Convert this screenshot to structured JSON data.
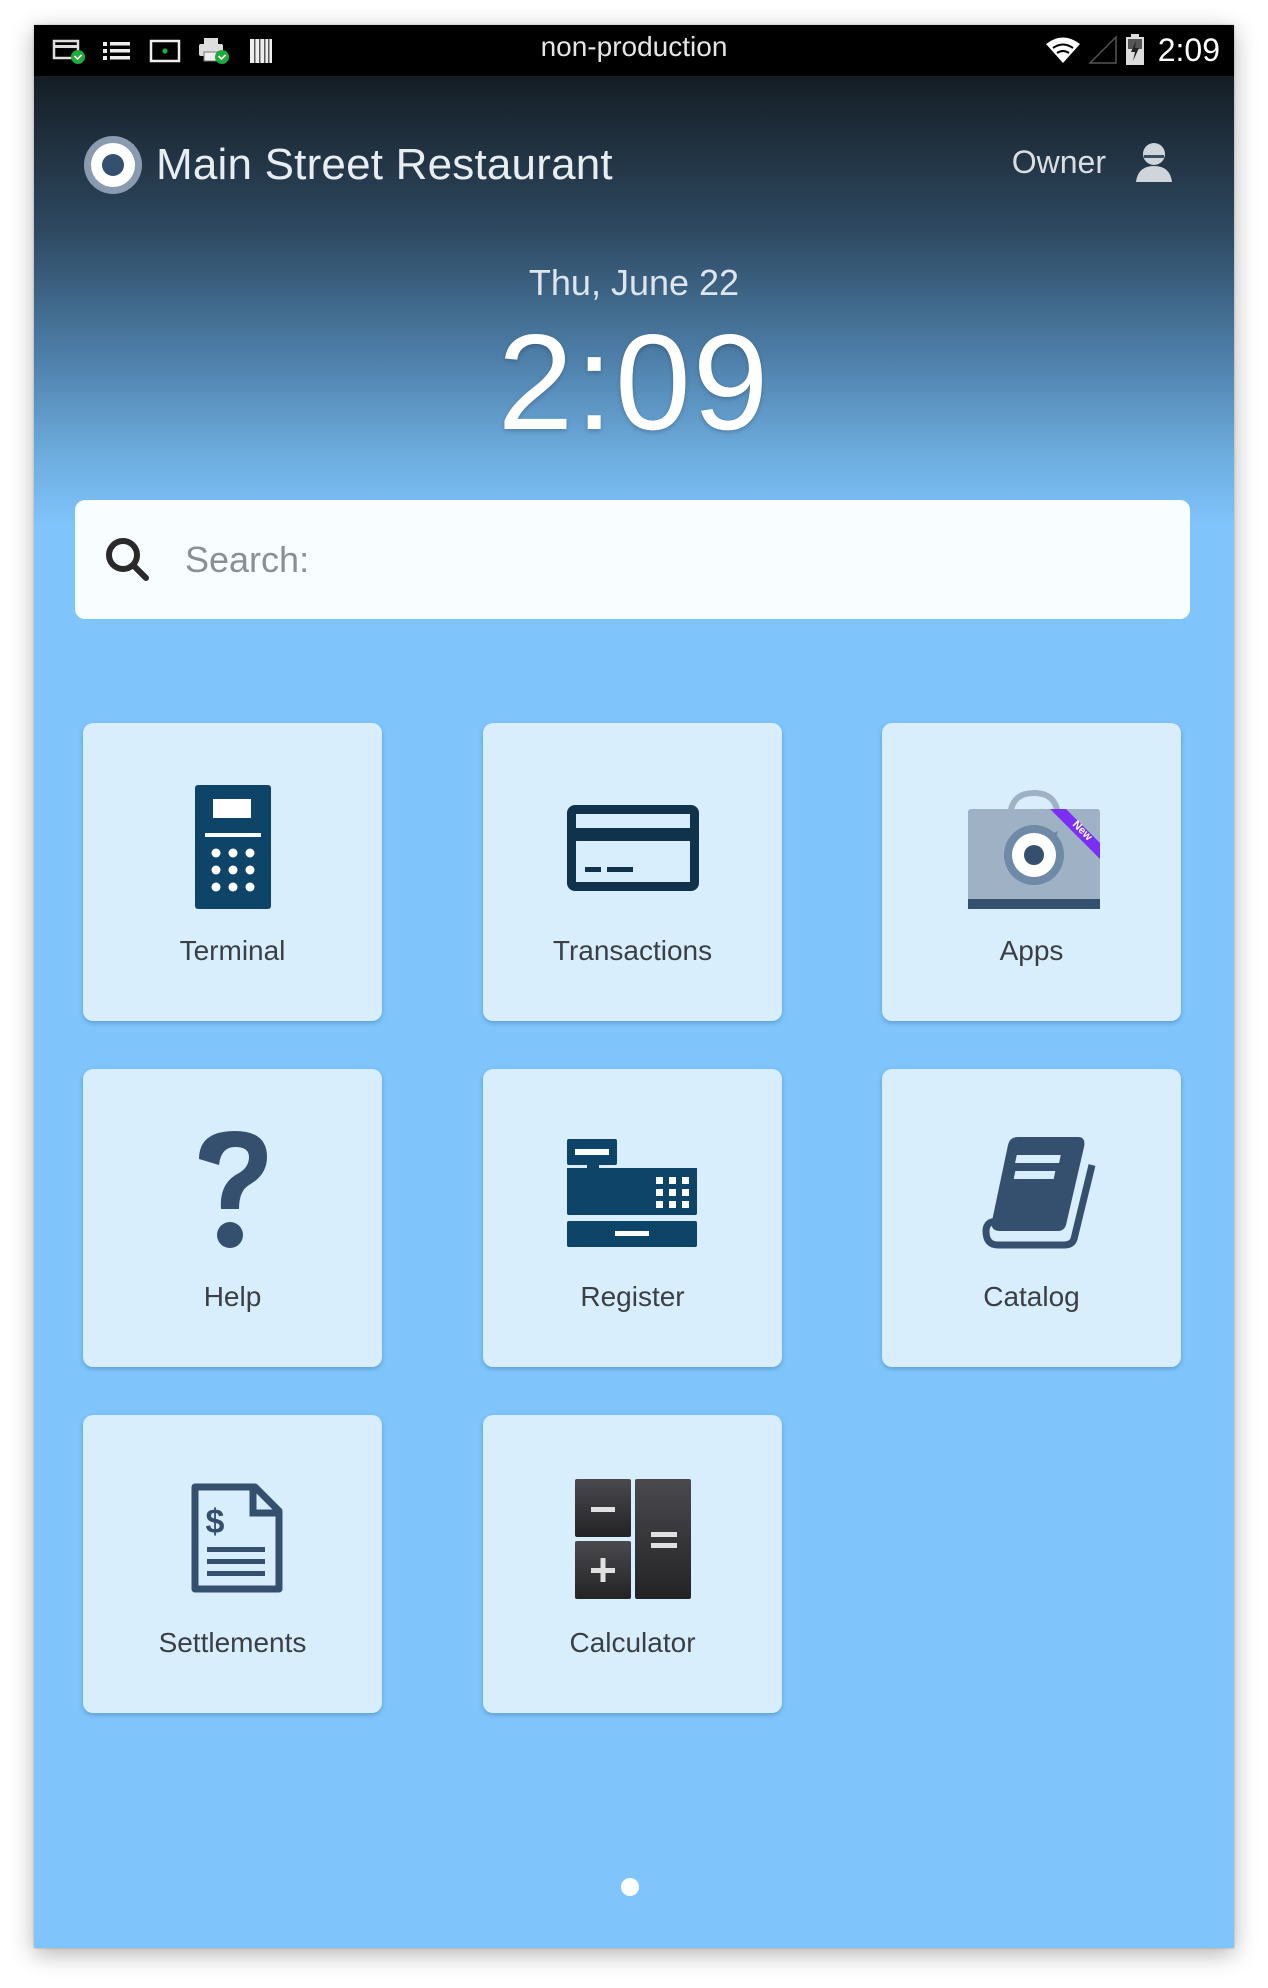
{
  "status_bar": {
    "environment_label": "non-production",
    "time": "2:09",
    "left_icons": [
      "card-reader-connected-icon",
      "list-icon",
      "screen-icon",
      "printer-connected-icon",
      "barcode-icon"
    ],
    "right_icons": [
      "wifi-icon",
      "cell-signal-icon",
      "battery-charging-icon"
    ]
  },
  "header": {
    "merchant_name": "Main Street Restaurant",
    "user_role": "Owner",
    "date": "Thu, June 22",
    "time": "2:09"
  },
  "search": {
    "placeholder": "Search:",
    "value": ""
  },
  "apps": [
    {
      "label": "Terminal",
      "icon": "terminal-icon"
    },
    {
      "label": "Transactions",
      "icon": "credit-card-icon"
    },
    {
      "label": "Apps",
      "icon": "app-market-bag-icon",
      "badge": "New"
    },
    {
      "label": "Help",
      "icon": "question-mark-icon"
    },
    {
      "label": "Register",
      "icon": "cash-register-icon"
    },
    {
      "label": "Catalog",
      "icon": "book-icon"
    },
    {
      "label": "Settlements",
      "icon": "invoice-dollar-icon"
    },
    {
      "label": "Calculator",
      "icon": "calculator-icon"
    }
  ],
  "pagination": {
    "current_page": 1,
    "total_pages": 1
  },
  "colors": {
    "background": "#7fc4fb",
    "tile": "#d8eefd",
    "icon_navy": "#0d4468",
    "icon_slate": "#34506e",
    "badge_purple": "#7b2ff2"
  }
}
